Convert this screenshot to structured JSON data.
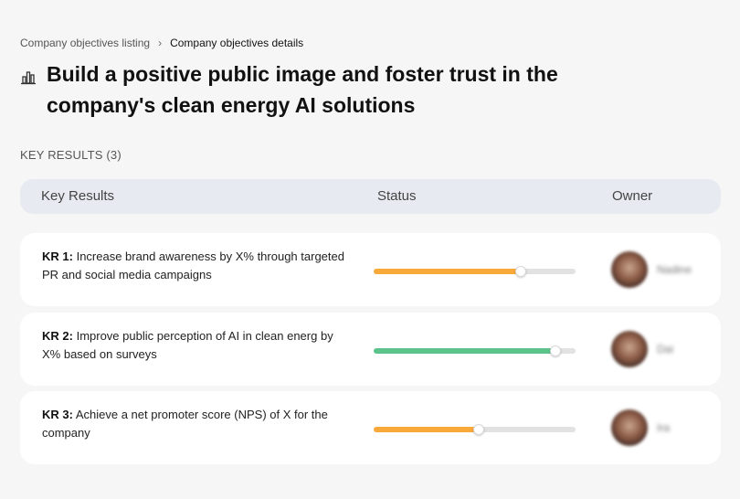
{
  "breadcrumb": {
    "parent": "Company objectives listing",
    "current": "Company objectives details"
  },
  "objective": {
    "icon": "chart-bar-icon",
    "title": "Build a positive public image and foster trust in the company's clean energy AI solutions"
  },
  "key_results_label": "KEY RESULTS (3)",
  "table": {
    "col_key_results": "Key Results",
    "col_status": "Status",
    "col_owner": "Owner"
  },
  "key_results": [
    {
      "id": "KR 1:",
      "text": "Increase brand awareness by X% through targeted PR and social media campaigns",
      "progress": 0.73,
      "color": "#f8a93a",
      "owner": "Nadine"
    },
    {
      "id": "KR 2:",
      "text": "Improve public perception of AI in clean energ by X% based on surveys",
      "progress": 0.9,
      "color": "#5cc48b",
      "owner": "Dai"
    },
    {
      "id": "KR 3:",
      "text": "Achieve a net promoter score (NPS) of X for the company",
      "progress": 0.52,
      "color": "#f8a93a",
      "owner": "Ira"
    }
  ]
}
